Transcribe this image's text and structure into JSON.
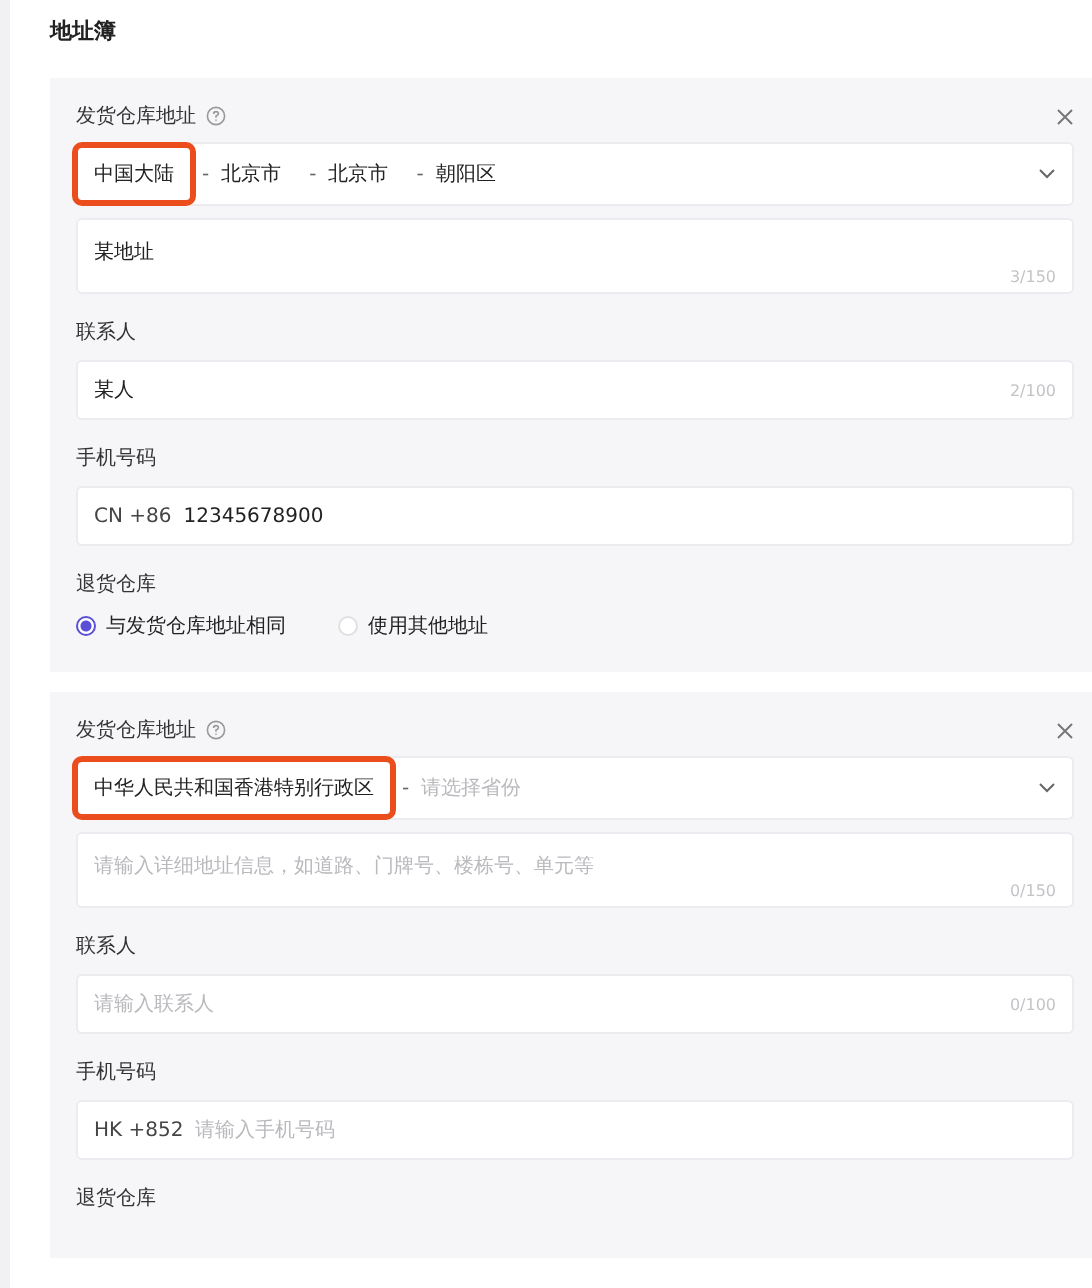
{
  "title": "地址簿",
  "cards": [
    {
      "warehouse_label": "发货仓库地址",
      "region": {
        "parts": [
          "中国大陆",
          "北京市",
          "北京市",
          "朝阳区"
        ],
        "separator": "-",
        "highlighted": true
      },
      "address": {
        "value": "某地址",
        "count": "3/150"
      },
      "contact_label": "联系人",
      "contact": {
        "value": "某人",
        "count": "2/100"
      },
      "phone_label": "手机号码",
      "phone": {
        "prefix": "CN +86",
        "value": "12345678900"
      },
      "return_label": "退货仓库",
      "return_options": [
        {
          "label": "与发货仓库地址相同",
          "selected": true
        },
        {
          "label": "使用其他地址",
          "selected": false
        }
      ]
    },
    {
      "warehouse_label": "发货仓库地址",
      "region": {
        "parts": [
          "中华人民共和国香港特别行政区"
        ],
        "separator": "-",
        "placeholder": "请选择省份",
        "highlighted": true
      },
      "address": {
        "placeholder": "请输入详细地址信息，如道路、门牌号、楼栋号、单元等",
        "count": "0/150"
      },
      "contact_label": "联系人",
      "contact": {
        "placeholder": "请输入联系人",
        "count": "0/100"
      },
      "phone_label": "手机号码",
      "phone": {
        "prefix": "HK +852",
        "placeholder": "请输入手机号码"
      },
      "return_label": "退货仓库"
    }
  ]
}
